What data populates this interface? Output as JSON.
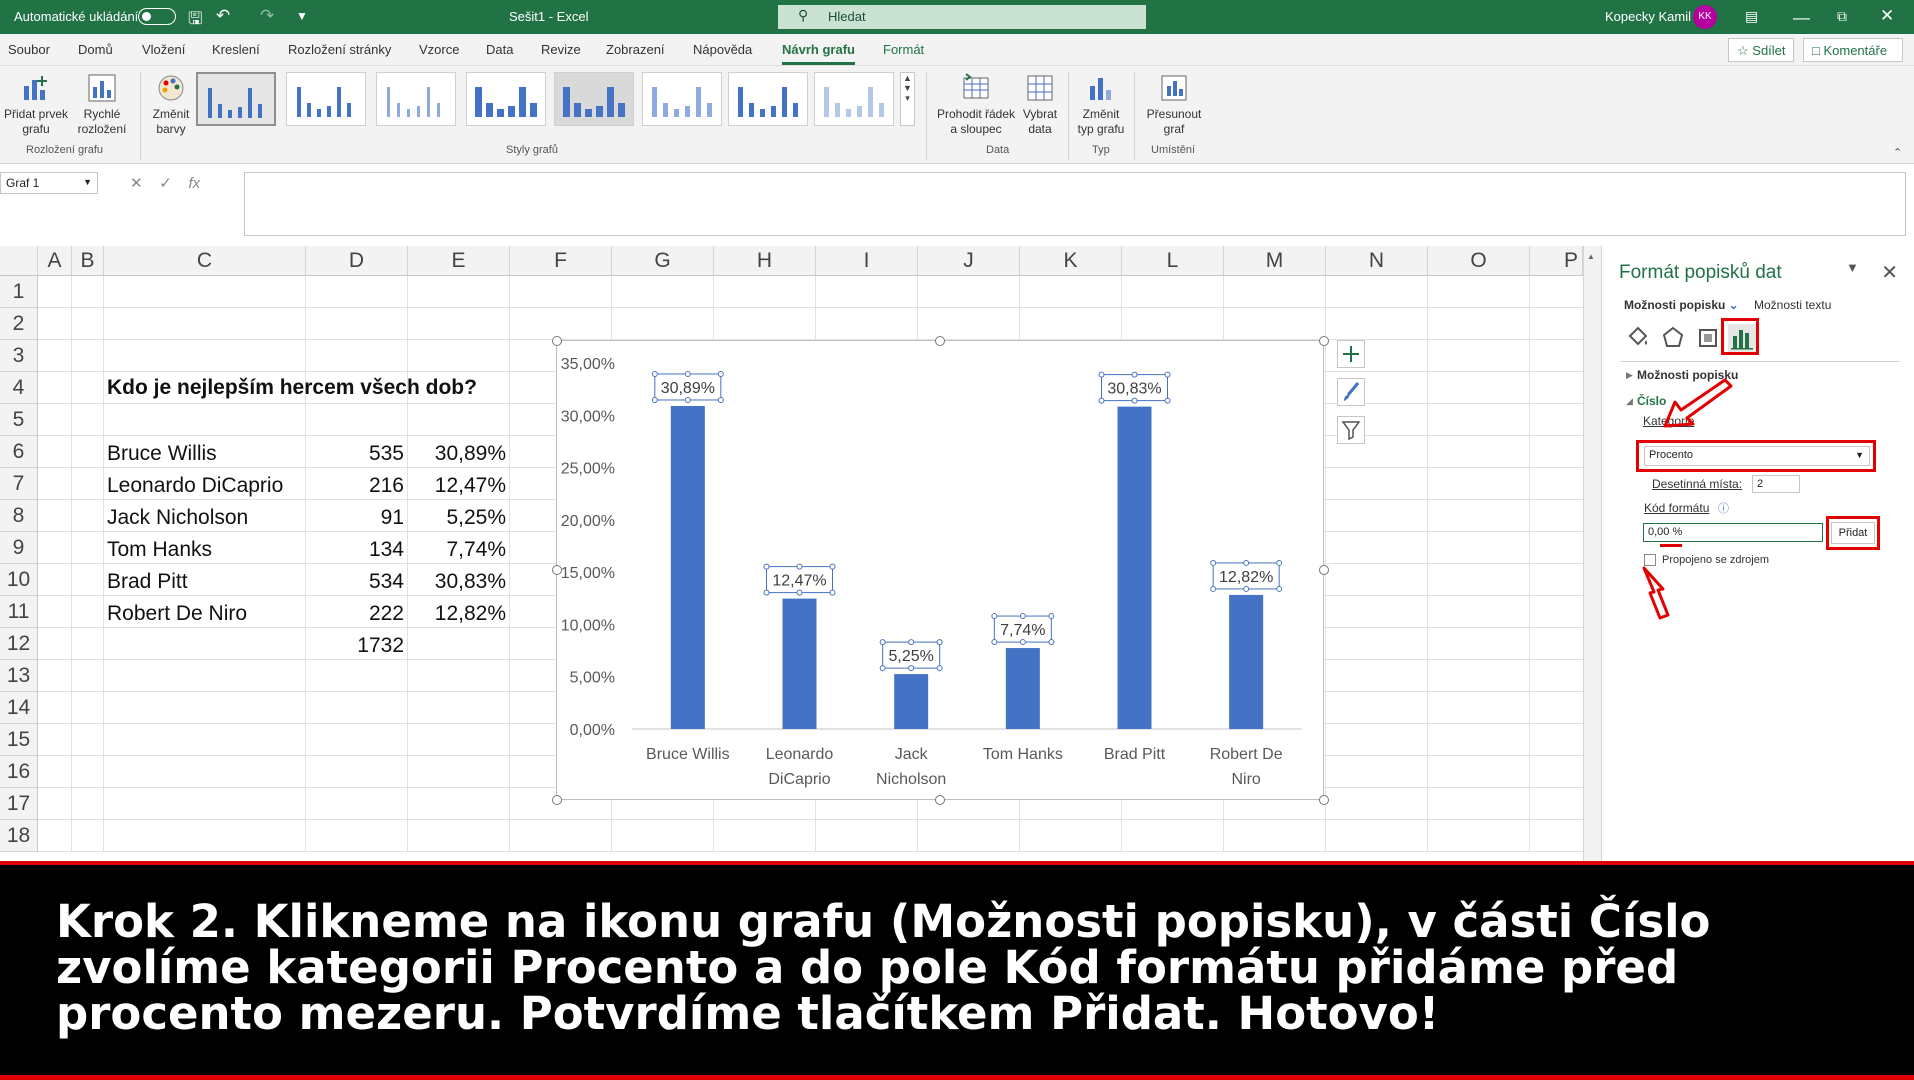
{
  "titlebar": {
    "autosave_label": "Automatické ukládání",
    "doc_title": "Sešit1  -  Excel",
    "search_label": "Hledat",
    "user_name": "Kopecky Kamil",
    "user_initials": "KK"
  },
  "menu": {
    "tabs": [
      "Soubor",
      "Domů",
      "Vložení",
      "Kreslení",
      "Rozložení stránky",
      "Vzorce",
      "Data",
      "Revize",
      "Zobrazení",
      "Nápověda",
      "Návrh grafu",
      "Formát"
    ],
    "active_tab": "Návrh grafu",
    "share_label": "Sdílet",
    "comments_label": "Komentáře"
  },
  "ribbon": {
    "add_element": "Přidat prvek grafu",
    "quick_layout": "Rychlé rozložení",
    "change_colors": "Změnit barvy",
    "group_layout": "Rozložení grafu",
    "group_styles": "Styly grafů",
    "switch_row_col": "Prohodit řádek a sloupec",
    "select_data": "Vybrat data",
    "group_data": "Data",
    "change_type": "Změnit typ grafu",
    "group_type": "Typ",
    "move_chart": "Přesunout graf",
    "group_location": "Umístění"
  },
  "formula": {
    "name_box": "Graf 1",
    "fx": "fx"
  },
  "sheet": {
    "columns": [
      "A",
      "B",
      "C",
      "D",
      "E",
      "F",
      "G",
      "H",
      "I",
      "J",
      "K",
      "L",
      "M",
      "N",
      "O",
      "P"
    ],
    "rows": [
      "1",
      "2",
      "3",
      "4",
      "5",
      "6",
      "7",
      "8",
      "9",
      "10",
      "11",
      "12",
      "13",
      "14",
      "15",
      "16",
      "17",
      "18"
    ],
    "heading": "Kdo je nejlepším hercem všech dob?",
    "data": [
      {
        "name": "Bruce Willis",
        "votes": "535",
        "pct": "30,89%"
      },
      {
        "name": "Leonardo DiCaprio",
        "votes": "216",
        "pct": "12,47%"
      },
      {
        "name": "Jack Nicholson",
        "votes": "91",
        "pct": "5,25%"
      },
      {
        "name": "Tom Hanks",
        "votes": "134",
        "pct": "7,74%"
      },
      {
        "name": "Brad Pitt",
        "votes": "534",
        "pct": "30,83%"
      },
      {
        "name": "Robert De Niro",
        "votes": "222",
        "pct": "12,82%"
      }
    ],
    "total": "1732"
  },
  "chart_data": {
    "type": "bar",
    "categories": [
      [
        "Bruce Willis"
      ],
      [
        "Leonardo",
        "DiCaprio"
      ],
      [
        "Jack",
        "Nicholson"
      ],
      [
        "Tom Hanks"
      ],
      [
        "Brad Pitt"
      ],
      [
        "Robert De",
        "Niro"
      ]
    ],
    "values": [
      30.89,
      12.47,
      5.25,
      7.74,
      30.83,
      12.82
    ],
    "data_labels": [
      "30,89%",
      "12,47%",
      "5,25%",
      "7,74%",
      "30,83%",
      "12,82%"
    ],
    "y_ticks": [
      "0,00%",
      "5,00%",
      "10,00%",
      "15,00%",
      "20,00%",
      "25,00%",
      "30,00%",
      "35,00%"
    ],
    "ylim": [
      0,
      35
    ],
    "bar_color": "#4472c4",
    "grid": false
  },
  "pane": {
    "title": "Formát popisků dat",
    "tab_label_options": "Možnosti popisku",
    "tab_text_options": "Možnosti textu",
    "section_label_options": "Možnosti popisku",
    "section_number": "Číslo",
    "category_label": "Kategorie",
    "category_value": "Procento",
    "decimals_label": "Desetinná místa:",
    "decimals_value": "2",
    "format_code_label": "Kód formátu",
    "format_code_value": "0,00 %",
    "add_button": "Přidat",
    "linked_source": "Propojeno se zdrojem"
  },
  "caption": {
    "text": "Krok 2. Klikneme na ikonu grafu (Možnosti popisku), v části Číslo zvolíme kategorii Procento a do pole Kód formátu přidáme před procento mezeru.  Potvrdíme tlačítkem Přidat. Hotovo!"
  },
  "colors": {
    "excel_green": "#217346",
    "highlight_red": "#e30000",
    "bar_blue": "#4472c4"
  }
}
